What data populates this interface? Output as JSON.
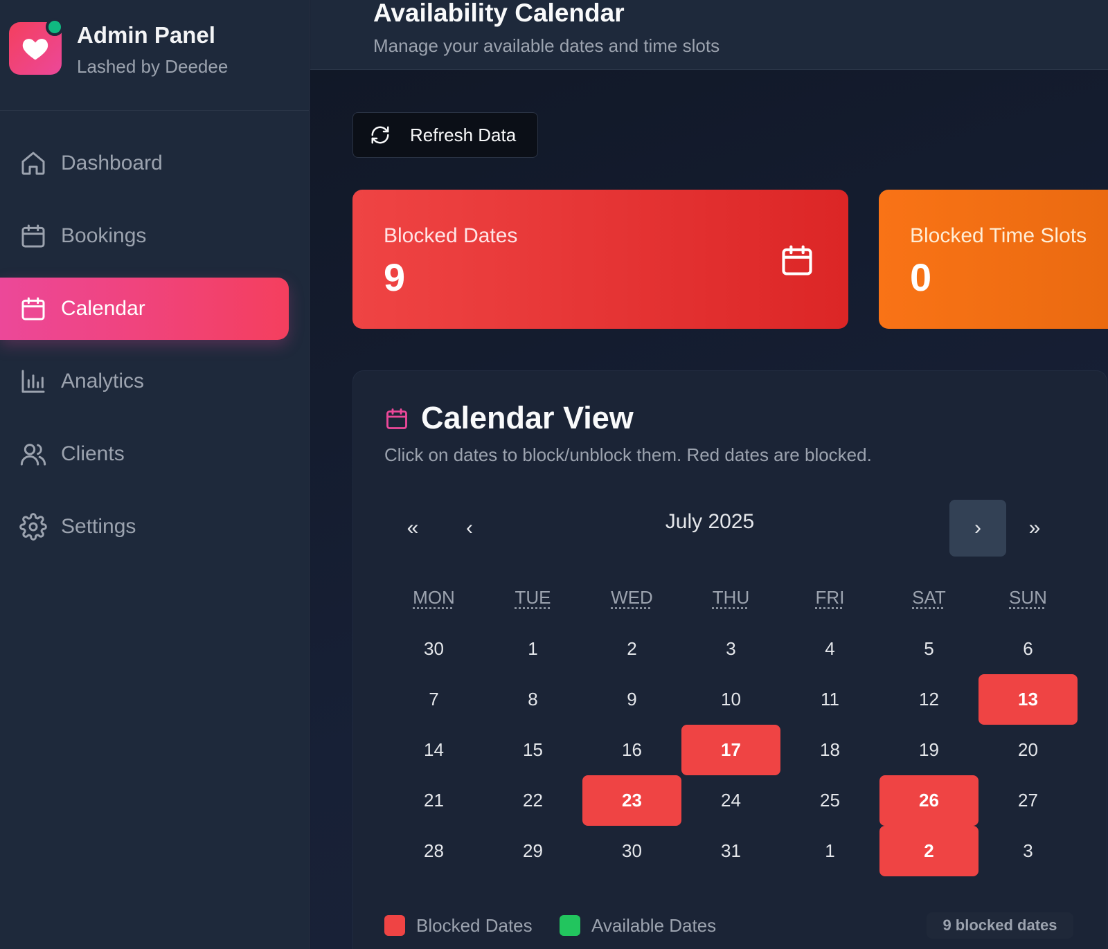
{
  "brand": {
    "title": "Admin Panel",
    "subtitle": "Lashed by Deedee",
    "logo_icon": "heart-icon",
    "status_color": "#10b981"
  },
  "sidebar": {
    "items": [
      {
        "label": "Dashboard",
        "icon": "home-icon",
        "active": false
      },
      {
        "label": "Bookings",
        "icon": "calendar-icon",
        "active": false
      },
      {
        "label": "Calendar",
        "icon": "calendar-icon",
        "active": true
      },
      {
        "label": "Analytics",
        "icon": "bar-chart-icon",
        "active": false
      },
      {
        "label": "Clients",
        "icon": "users-icon",
        "active": false
      },
      {
        "label": "Settings",
        "icon": "gear-icon",
        "active": false
      }
    ]
  },
  "header": {
    "title": "Availability Calendar",
    "subtitle": "Manage your available dates and time slots"
  },
  "toolbar": {
    "refresh_label": "Refresh Data"
  },
  "stats": [
    {
      "label": "Blocked Dates",
      "value": "9",
      "color": "#ef4444"
    },
    {
      "label": "Blocked Time Slots",
      "value": "0",
      "color": "#f97316"
    }
  ],
  "calendar": {
    "title": "Calendar View",
    "description": "Click on dates to block/unblock them. Red dates are blocked.",
    "month_label": "July 2025",
    "nav": {
      "prev_year": "«",
      "prev_month": "‹",
      "next_month": "›",
      "next_year": "»"
    },
    "weekdays": [
      "MON",
      "TUE",
      "WED",
      "THU",
      "FRI",
      "SAT",
      "SUN"
    ],
    "weeks": [
      [
        {
          "d": "30"
        },
        {
          "d": "1"
        },
        {
          "d": "2"
        },
        {
          "d": "3"
        },
        {
          "d": "4"
        },
        {
          "d": "5"
        },
        {
          "d": "6"
        }
      ],
      [
        {
          "d": "7"
        },
        {
          "d": "8"
        },
        {
          "d": "9"
        },
        {
          "d": "10"
        },
        {
          "d": "11"
        },
        {
          "d": "12"
        },
        {
          "d": "13",
          "blocked": true
        }
      ],
      [
        {
          "d": "14"
        },
        {
          "d": "15"
        },
        {
          "d": "16"
        },
        {
          "d": "17",
          "blocked": true
        },
        {
          "d": "18"
        },
        {
          "d": "19"
        },
        {
          "d": "20"
        }
      ],
      [
        {
          "d": "21"
        },
        {
          "d": "22"
        },
        {
          "d": "23",
          "blocked": true
        },
        {
          "d": "24"
        },
        {
          "d": "25"
        },
        {
          "d": "26",
          "blocked": true
        },
        {
          "d": "27"
        }
      ],
      [
        {
          "d": "28"
        },
        {
          "d": "29"
        },
        {
          "d": "30"
        },
        {
          "d": "31"
        },
        {
          "d": "1"
        },
        {
          "d": "2",
          "blocked": true
        },
        {
          "d": "3"
        }
      ]
    ],
    "blocked_color": "#ef4444",
    "available_color": "#22c55e"
  },
  "legend": {
    "blocked_label": "Blocked Dates",
    "available_label": "Available Dates",
    "count_label": "9 blocked dates"
  }
}
